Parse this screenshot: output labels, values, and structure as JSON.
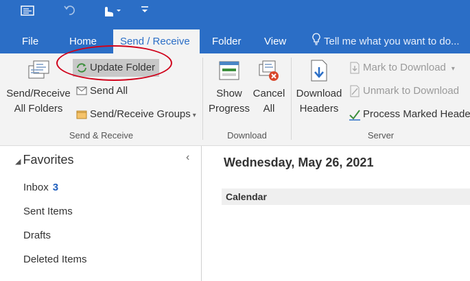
{
  "quick_access": {
    "icons": [
      "send-receive-all-icon",
      "undo-icon",
      "touch-mode-icon",
      "customize-qat-icon"
    ]
  },
  "tabs": [
    {
      "label": "File"
    },
    {
      "label": "Home"
    },
    {
      "label": "Send / Receive"
    },
    {
      "label": "Folder"
    },
    {
      "label": "View"
    }
  ],
  "tell_me": "Tell me what you want to do...",
  "ribbon": {
    "send_receive_group": {
      "label": "Send & Receive",
      "send_receive_all": [
        "Send/Receive",
        "All Folders"
      ],
      "update_folder": "Update Folder",
      "send_all": "Send All",
      "groups": "Send/Receive Groups"
    },
    "download_group": {
      "label": "Download",
      "show_progress": [
        "Show",
        "Progress"
      ],
      "cancel_all": [
        "Cancel",
        "All"
      ]
    },
    "server_group": {
      "label": "Server",
      "download_headers": [
        "Download",
        "Headers"
      ],
      "mark_to_download": "Mark to Download",
      "unmark_to_download": "Unmark to Download",
      "process_marked_headers": "Process Marked Header"
    }
  },
  "folders": {
    "favorites_label": "Favorites",
    "items": [
      {
        "name": "Inbox",
        "count": "3"
      },
      {
        "name": "Sent Items",
        "count": ""
      },
      {
        "name": "Drafts",
        "count": ""
      },
      {
        "name": "Deleted Items",
        "count": ""
      }
    ]
  },
  "main": {
    "date_heading": "Wednesday, May 26, 2021",
    "calendar_label": "Calendar"
  },
  "colors": {
    "ribbon_blue": "#2b6ec6",
    "highlight_circle": "#d0021b",
    "inbox_count": "#1e5ebd"
  }
}
